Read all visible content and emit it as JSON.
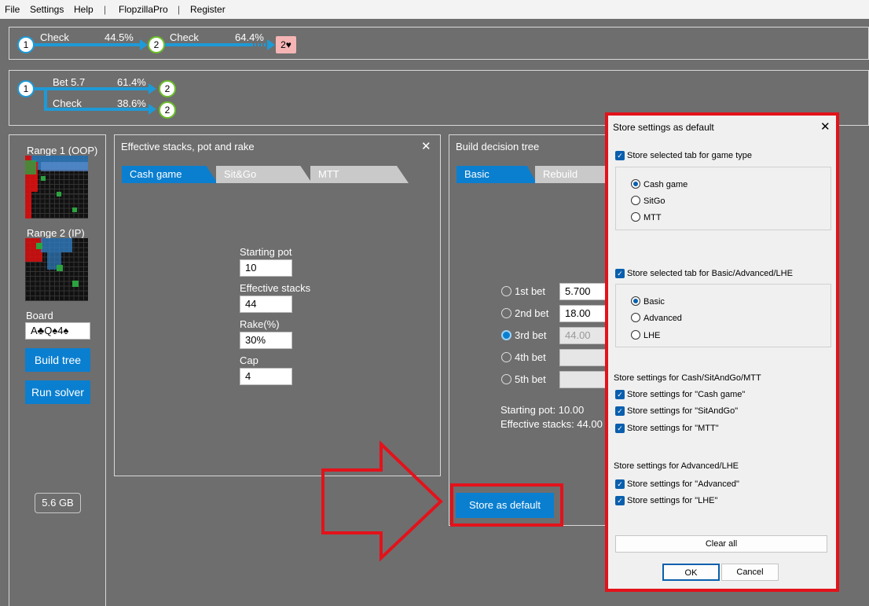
{
  "menu": {
    "file": "File",
    "settings": "Settings",
    "help": "Help",
    "sep1": "|",
    "flopzilla": "FlopzillaPro",
    "sep2": "|",
    "register": "Register"
  },
  "tree1": {
    "node1": "1",
    "label1": "Check",
    "pct1": "44.5%",
    "node2": "2",
    "label2": "Check",
    "pct2": "64.4%",
    "card": "2♥"
  },
  "tree2": {
    "node1": "1",
    "bet_label": "Bet 5.7",
    "bet_pct": "61.4%",
    "node_bet": "2",
    "check_label": "Check",
    "check_pct": "38.6%",
    "node_check": "2"
  },
  "left": {
    "range1_label": "Range 1 (OOP)",
    "range2_label": "Range 2 (IP)",
    "board_label": "Board",
    "board_value": "A♣Q♠4♠",
    "build_tree": "Build tree",
    "run_solver": "Run solver",
    "memory": "5.6 GB"
  },
  "stacks_panel": {
    "title": "Effective stacks, pot and rake",
    "close": "✕",
    "tabs": [
      "Cash game",
      "Sit&Go",
      "MTT"
    ],
    "starting_pot_label": "Starting pot",
    "starting_pot": "10",
    "effective_stacks_label": "Effective stacks",
    "effective_stacks": "44",
    "rake_label": "Rake(%)",
    "rake": "30%",
    "cap_label": "Cap",
    "cap": "4"
  },
  "decision_panel": {
    "title": "Build decision tree",
    "tabs": [
      "Basic",
      "Rebuild"
    ],
    "bets": [
      {
        "label": "1st bet",
        "value": "5.700"
      },
      {
        "label": "2nd bet",
        "value": "18.00"
      },
      {
        "label": "3rd bet",
        "value": "44.00"
      },
      {
        "label": "4th bet",
        "value": ""
      },
      {
        "label": "5th bet",
        "value": ""
      }
    ],
    "starting_pot": "Starting pot: 10.00",
    "effective_stacks": "Effective stacks: 44.00",
    "store_default": "Store as default"
  },
  "dialog": {
    "title": "Store settings as default",
    "close": "✕",
    "store_tab_game_type": "Store selected tab for game type",
    "game_types": [
      "Cash game",
      "SitGo",
      "MTT"
    ],
    "store_tab_basic": "Store selected tab for Basic/Advanced/LHE",
    "basic_types": [
      "Basic",
      "Advanced",
      "LHE"
    ],
    "section_cash": "Store settings for Cash/SitAndGo/MTT",
    "cash_items": [
      "Store settings for \"Cash game\"",
      "Store settings for \"SitAndGo\"",
      "Store settings for \"MTT\""
    ],
    "section_adv": "Store settings for Advanced/LHE",
    "adv_items": [
      "Store settings for \"Advanced\"",
      "Store settings for \"LHE\""
    ],
    "clear_all": "Clear all",
    "ok": "OK",
    "cancel": "Cancel"
  },
  "colors": {
    "accent": "#0a7fd0",
    "highlight_red": "#e3121b",
    "tree_line": "#1e9ad6",
    "node_green": "#6cbf2a"
  }
}
